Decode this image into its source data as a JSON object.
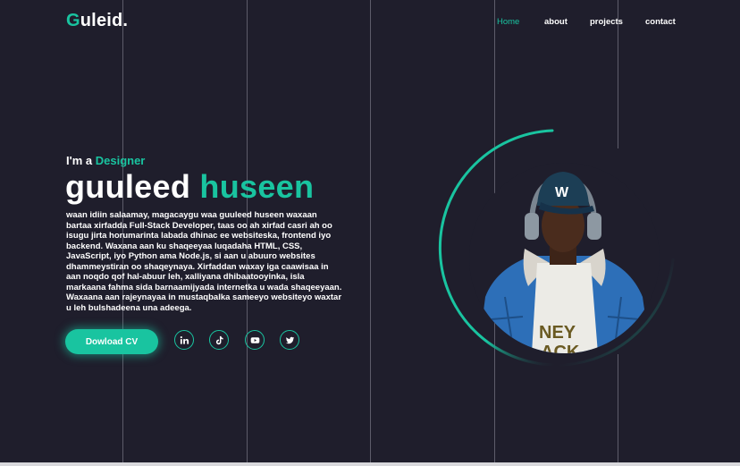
{
  "header": {
    "logo_first": "G",
    "logo_rest": "uleid."
  },
  "nav": {
    "items": [
      {
        "label": "Home",
        "active": true
      },
      {
        "label": "about",
        "active": false
      },
      {
        "label": "projects",
        "active": false
      },
      {
        "label": "contact",
        "active": false
      }
    ]
  },
  "hero": {
    "intro": "I'm a",
    "role": "Designer",
    "first_name": "guuleed",
    "last_name": "huseen",
    "description": "waan idiin salaamay, magacaygu waa guuleed huseen waxaan bartaa xirfadda Full-Stack Developer, taas oo ah xirfad casri ah oo isugu jirta horumarinta labada dhinac ee websiteska, frontend iyo backend. Waxana aan ku shaqeeyaa luqadaha HTML, CSS, JavaScript, iyo Python ama Node.js, si aan u abuuro websites dhammeystiran oo shaqeynaya. Xirfaddan waxay iga caawisaa in aan noqdo qof hal-abuur leh, xalliyana dhibaatooyinka, isla markaana fahma sida barnaamijyada internetka u wada shaqeeyaan. Waxaana aan rajeynayaa in mustaqbalka sameeyo websiteyo waxtar u leh bulshadeena una adeega.",
    "cv_button": "Dowload CV"
  },
  "socials": [
    {
      "name": "linkedin-icon"
    },
    {
      "name": "tiktok-icon"
    },
    {
      "name": "youtube-icon"
    },
    {
      "name": "twitter-icon"
    }
  ],
  "theme": {
    "background": "#1f1e2c",
    "accent": "#19c4a0",
    "text": "#ffffff"
  }
}
